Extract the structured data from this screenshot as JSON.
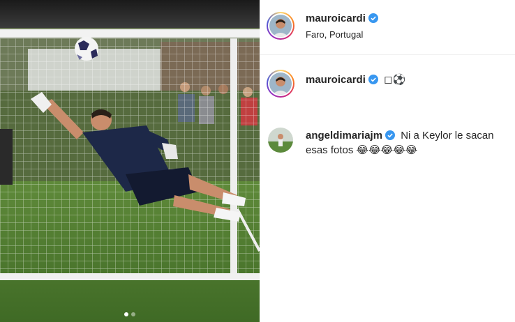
{
  "post": {
    "username": "mauroicardi",
    "location": "Faro, Portugal",
    "caption_username": "mauroicardi",
    "caption_text": "◻⚽",
    "carousel_dots": [
      true,
      false
    ]
  },
  "comments": [
    {
      "username": "angeldimariajm",
      "text": "Ni a Keylor le sacan esas fotos",
      "emojis": "😂😂😂😂😂"
    }
  ],
  "colors": {
    "verified": "#3897f0",
    "text": "#262626",
    "divider": "#efefef"
  },
  "icons": [
    "verified-badge-icon"
  ]
}
